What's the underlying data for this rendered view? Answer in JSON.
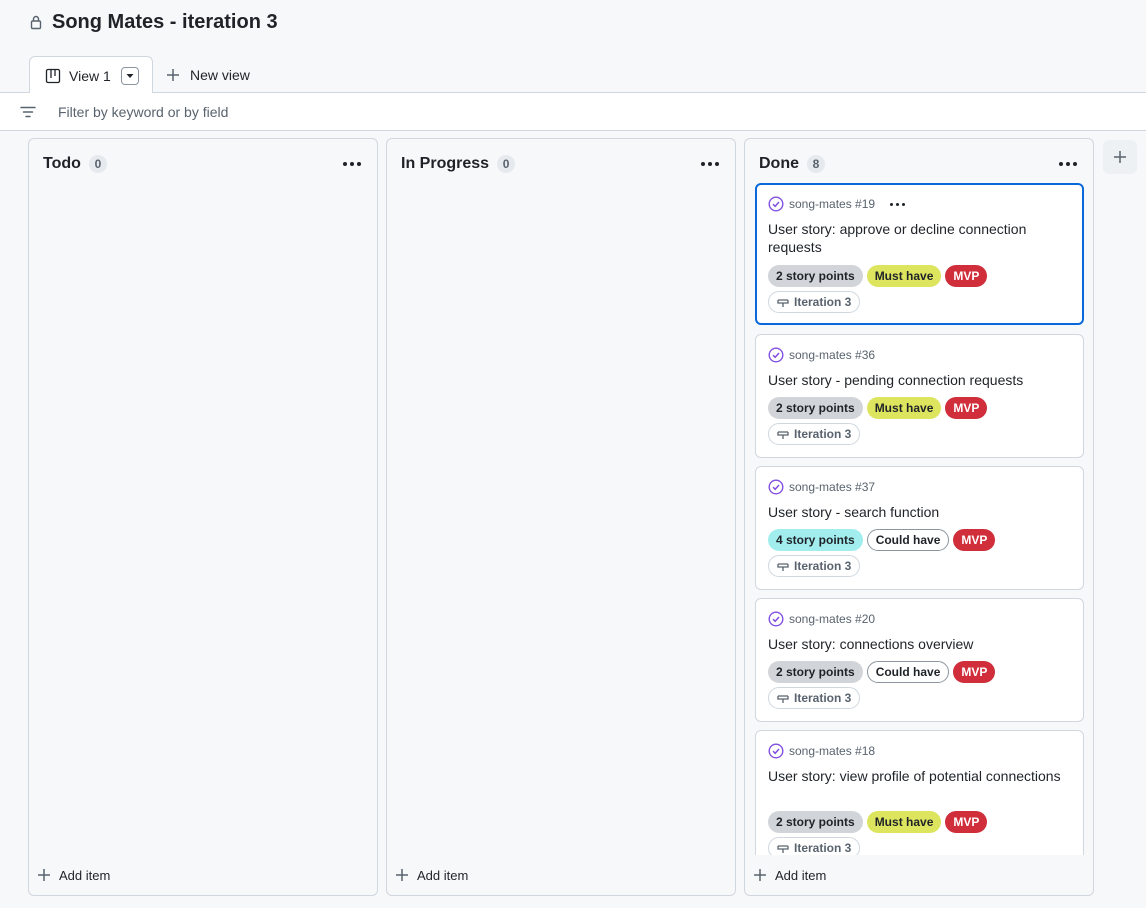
{
  "project": {
    "title": "Song Mates - iteration 3"
  },
  "tabs": {
    "active_label": "View 1",
    "new_view_label": "New view"
  },
  "filter": {
    "placeholder": "Filter by keyword or by field"
  },
  "columns": [
    {
      "title": "Todo",
      "count": "0",
      "add_label": "Add item"
    },
    {
      "title": "In Progress",
      "count": "0",
      "add_label": "Add item"
    },
    {
      "title": "Done",
      "count": "8",
      "add_label": "Add item"
    }
  ],
  "cards": [
    {
      "ref": "song-mates #19",
      "title": "User story: approve or decline connection requests",
      "points": "2 story points",
      "priority": "Must have",
      "tag": "MVP",
      "iteration": "Iteration 3"
    },
    {
      "ref": "song-mates #36",
      "title": "User story - pending connection requests",
      "points": "2 story points",
      "priority": "Must have",
      "tag": "MVP",
      "iteration": "Iteration 3"
    },
    {
      "ref": "song-mates #37",
      "title": "User story - search function",
      "points": "4 story points",
      "priority": "Could have",
      "tag": "MVP",
      "iteration": "Iteration 3"
    },
    {
      "ref": "song-mates #20",
      "title": "User story: connections overview",
      "points": "2 story points",
      "priority": "Could have",
      "tag": "MVP",
      "iteration": "Iteration 3"
    },
    {
      "ref": "song-mates #18",
      "title": "User story: view profile of potential connections",
      "points": "2 story points",
      "priority": "Must have",
      "tag": "MVP",
      "iteration": "Iteration 3"
    }
  ],
  "colors": {
    "accent": "#0969da",
    "done_icon": "#8250df",
    "mvp": "#cf2e3a",
    "must_have": "#dde55f",
    "four_points": "#a2eeef"
  },
  "icons": [
    "lock-icon",
    "board-icon",
    "chevron-down-icon",
    "plus-icon",
    "filter-icon",
    "kebab-icon",
    "check-circle-icon",
    "iteration-icon"
  ]
}
